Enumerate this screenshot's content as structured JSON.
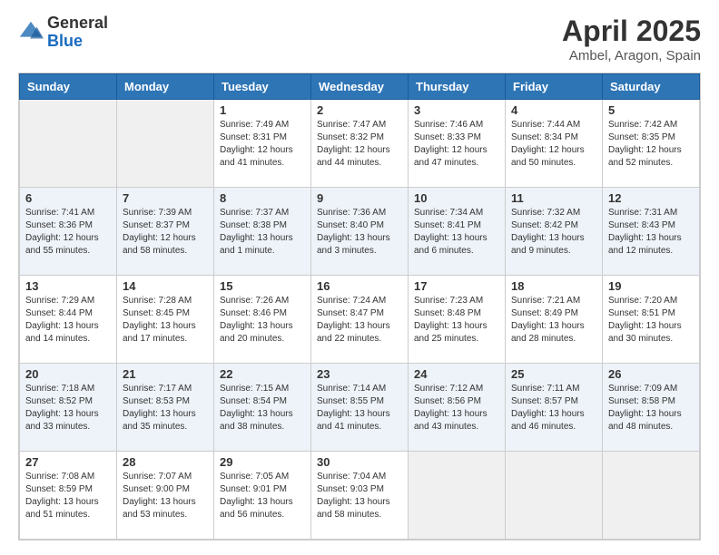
{
  "logo": {
    "general": "General",
    "blue": "Blue"
  },
  "header": {
    "title": "April 2025",
    "subtitle": "Ambel, Aragon, Spain"
  },
  "weekdays": [
    "Sunday",
    "Monday",
    "Tuesday",
    "Wednesday",
    "Thursday",
    "Friday",
    "Saturday"
  ],
  "weeks": [
    [
      {
        "day": "",
        "sunrise": "",
        "sunset": "",
        "daylight": ""
      },
      {
        "day": "",
        "sunrise": "",
        "sunset": "",
        "daylight": ""
      },
      {
        "day": "1",
        "sunrise": "Sunrise: 7:49 AM",
        "sunset": "Sunset: 8:31 PM",
        "daylight": "Daylight: 12 hours and 41 minutes."
      },
      {
        "day": "2",
        "sunrise": "Sunrise: 7:47 AM",
        "sunset": "Sunset: 8:32 PM",
        "daylight": "Daylight: 12 hours and 44 minutes."
      },
      {
        "day": "3",
        "sunrise": "Sunrise: 7:46 AM",
        "sunset": "Sunset: 8:33 PM",
        "daylight": "Daylight: 12 hours and 47 minutes."
      },
      {
        "day": "4",
        "sunrise": "Sunrise: 7:44 AM",
        "sunset": "Sunset: 8:34 PM",
        "daylight": "Daylight: 12 hours and 50 minutes."
      },
      {
        "day": "5",
        "sunrise": "Sunrise: 7:42 AM",
        "sunset": "Sunset: 8:35 PM",
        "daylight": "Daylight: 12 hours and 52 minutes."
      }
    ],
    [
      {
        "day": "6",
        "sunrise": "Sunrise: 7:41 AM",
        "sunset": "Sunset: 8:36 PM",
        "daylight": "Daylight: 12 hours and 55 minutes."
      },
      {
        "day": "7",
        "sunrise": "Sunrise: 7:39 AM",
        "sunset": "Sunset: 8:37 PM",
        "daylight": "Daylight: 12 hours and 58 minutes."
      },
      {
        "day": "8",
        "sunrise": "Sunrise: 7:37 AM",
        "sunset": "Sunset: 8:38 PM",
        "daylight": "Daylight: 13 hours and 1 minute."
      },
      {
        "day": "9",
        "sunrise": "Sunrise: 7:36 AM",
        "sunset": "Sunset: 8:40 PM",
        "daylight": "Daylight: 13 hours and 3 minutes."
      },
      {
        "day": "10",
        "sunrise": "Sunrise: 7:34 AM",
        "sunset": "Sunset: 8:41 PM",
        "daylight": "Daylight: 13 hours and 6 minutes."
      },
      {
        "day": "11",
        "sunrise": "Sunrise: 7:32 AM",
        "sunset": "Sunset: 8:42 PM",
        "daylight": "Daylight: 13 hours and 9 minutes."
      },
      {
        "day": "12",
        "sunrise": "Sunrise: 7:31 AM",
        "sunset": "Sunset: 8:43 PM",
        "daylight": "Daylight: 13 hours and 12 minutes."
      }
    ],
    [
      {
        "day": "13",
        "sunrise": "Sunrise: 7:29 AM",
        "sunset": "Sunset: 8:44 PM",
        "daylight": "Daylight: 13 hours and 14 minutes."
      },
      {
        "day": "14",
        "sunrise": "Sunrise: 7:28 AM",
        "sunset": "Sunset: 8:45 PM",
        "daylight": "Daylight: 13 hours and 17 minutes."
      },
      {
        "day": "15",
        "sunrise": "Sunrise: 7:26 AM",
        "sunset": "Sunset: 8:46 PM",
        "daylight": "Daylight: 13 hours and 20 minutes."
      },
      {
        "day": "16",
        "sunrise": "Sunrise: 7:24 AM",
        "sunset": "Sunset: 8:47 PM",
        "daylight": "Daylight: 13 hours and 22 minutes."
      },
      {
        "day": "17",
        "sunrise": "Sunrise: 7:23 AM",
        "sunset": "Sunset: 8:48 PM",
        "daylight": "Daylight: 13 hours and 25 minutes."
      },
      {
        "day": "18",
        "sunrise": "Sunrise: 7:21 AM",
        "sunset": "Sunset: 8:49 PM",
        "daylight": "Daylight: 13 hours and 28 minutes."
      },
      {
        "day": "19",
        "sunrise": "Sunrise: 7:20 AM",
        "sunset": "Sunset: 8:51 PM",
        "daylight": "Daylight: 13 hours and 30 minutes."
      }
    ],
    [
      {
        "day": "20",
        "sunrise": "Sunrise: 7:18 AM",
        "sunset": "Sunset: 8:52 PM",
        "daylight": "Daylight: 13 hours and 33 minutes."
      },
      {
        "day": "21",
        "sunrise": "Sunrise: 7:17 AM",
        "sunset": "Sunset: 8:53 PM",
        "daylight": "Daylight: 13 hours and 35 minutes."
      },
      {
        "day": "22",
        "sunrise": "Sunrise: 7:15 AM",
        "sunset": "Sunset: 8:54 PM",
        "daylight": "Daylight: 13 hours and 38 minutes."
      },
      {
        "day": "23",
        "sunrise": "Sunrise: 7:14 AM",
        "sunset": "Sunset: 8:55 PM",
        "daylight": "Daylight: 13 hours and 41 minutes."
      },
      {
        "day": "24",
        "sunrise": "Sunrise: 7:12 AM",
        "sunset": "Sunset: 8:56 PM",
        "daylight": "Daylight: 13 hours and 43 minutes."
      },
      {
        "day": "25",
        "sunrise": "Sunrise: 7:11 AM",
        "sunset": "Sunset: 8:57 PM",
        "daylight": "Daylight: 13 hours and 46 minutes."
      },
      {
        "day": "26",
        "sunrise": "Sunrise: 7:09 AM",
        "sunset": "Sunset: 8:58 PM",
        "daylight": "Daylight: 13 hours and 48 minutes."
      }
    ],
    [
      {
        "day": "27",
        "sunrise": "Sunrise: 7:08 AM",
        "sunset": "Sunset: 8:59 PM",
        "daylight": "Daylight: 13 hours and 51 minutes."
      },
      {
        "day": "28",
        "sunrise": "Sunrise: 7:07 AM",
        "sunset": "Sunset: 9:00 PM",
        "daylight": "Daylight: 13 hours and 53 minutes."
      },
      {
        "day": "29",
        "sunrise": "Sunrise: 7:05 AM",
        "sunset": "Sunset: 9:01 PM",
        "daylight": "Daylight: 13 hours and 56 minutes."
      },
      {
        "day": "30",
        "sunrise": "Sunrise: 7:04 AM",
        "sunset": "Sunset: 9:03 PM",
        "daylight": "Daylight: 13 hours and 58 minutes."
      },
      {
        "day": "",
        "sunrise": "",
        "sunset": "",
        "daylight": ""
      },
      {
        "day": "",
        "sunrise": "",
        "sunset": "",
        "daylight": ""
      },
      {
        "day": "",
        "sunrise": "",
        "sunset": "",
        "daylight": ""
      }
    ]
  ]
}
